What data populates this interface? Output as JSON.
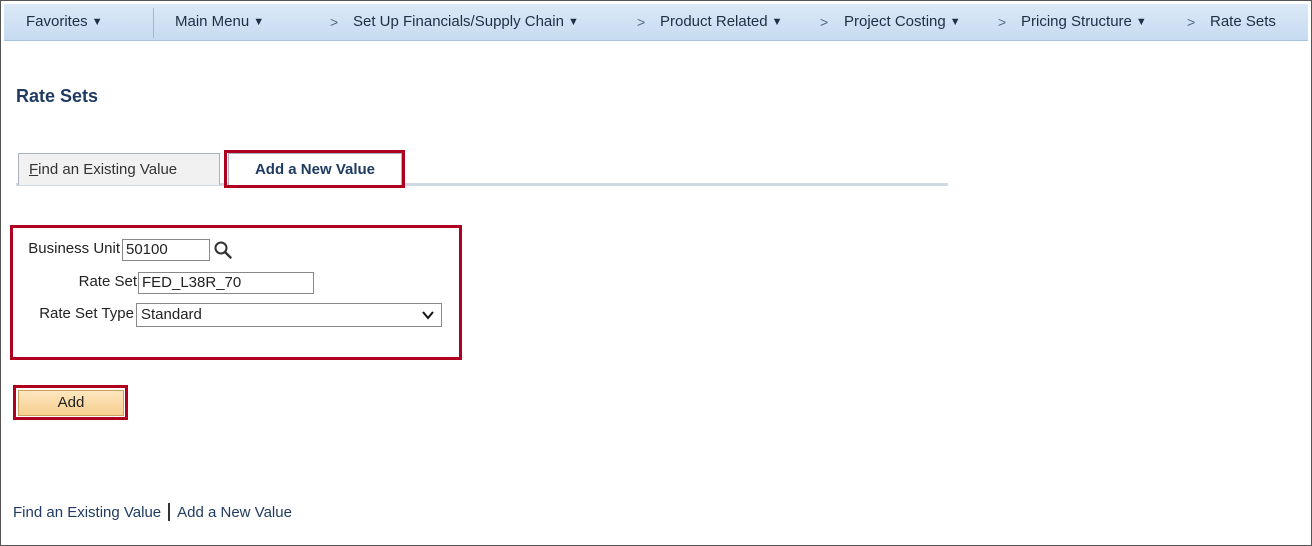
{
  "nav": {
    "favorites": "Favorites",
    "main_menu": "Main Menu",
    "separator": ">",
    "breadcrumbs": [
      "Set Up Financials/Supply Chain",
      "Product Related",
      "Project Costing",
      "Pricing Structure"
    ],
    "current": "Rate Sets"
  },
  "page": {
    "title": "Rate Sets"
  },
  "tabs": {
    "find_accesskey": "F",
    "find_rest": "ind an Existing Value",
    "add": "Add a New Value"
  },
  "form": {
    "business_unit_label": "Business Unit",
    "business_unit_value": "50100",
    "rate_set_label": "Rate Set",
    "rate_set_value": "FED_L38R_70",
    "rate_set_type_label": "Rate Set Type",
    "rate_set_type_value": "Standard"
  },
  "actions": {
    "add": "Add"
  },
  "footer": {
    "find": "Find an Existing Value",
    "add": "Add a New Value"
  },
  "icons": {
    "lookup": "magnifier-icon",
    "dropdown": "chevron-down-icon",
    "menu_caret": "caret-down-icon"
  },
  "colors": {
    "highlight": "#b00020",
    "title": "#1f3b62",
    "nav_bg": "#c6dbf1",
    "button": "#f7cf8f"
  }
}
